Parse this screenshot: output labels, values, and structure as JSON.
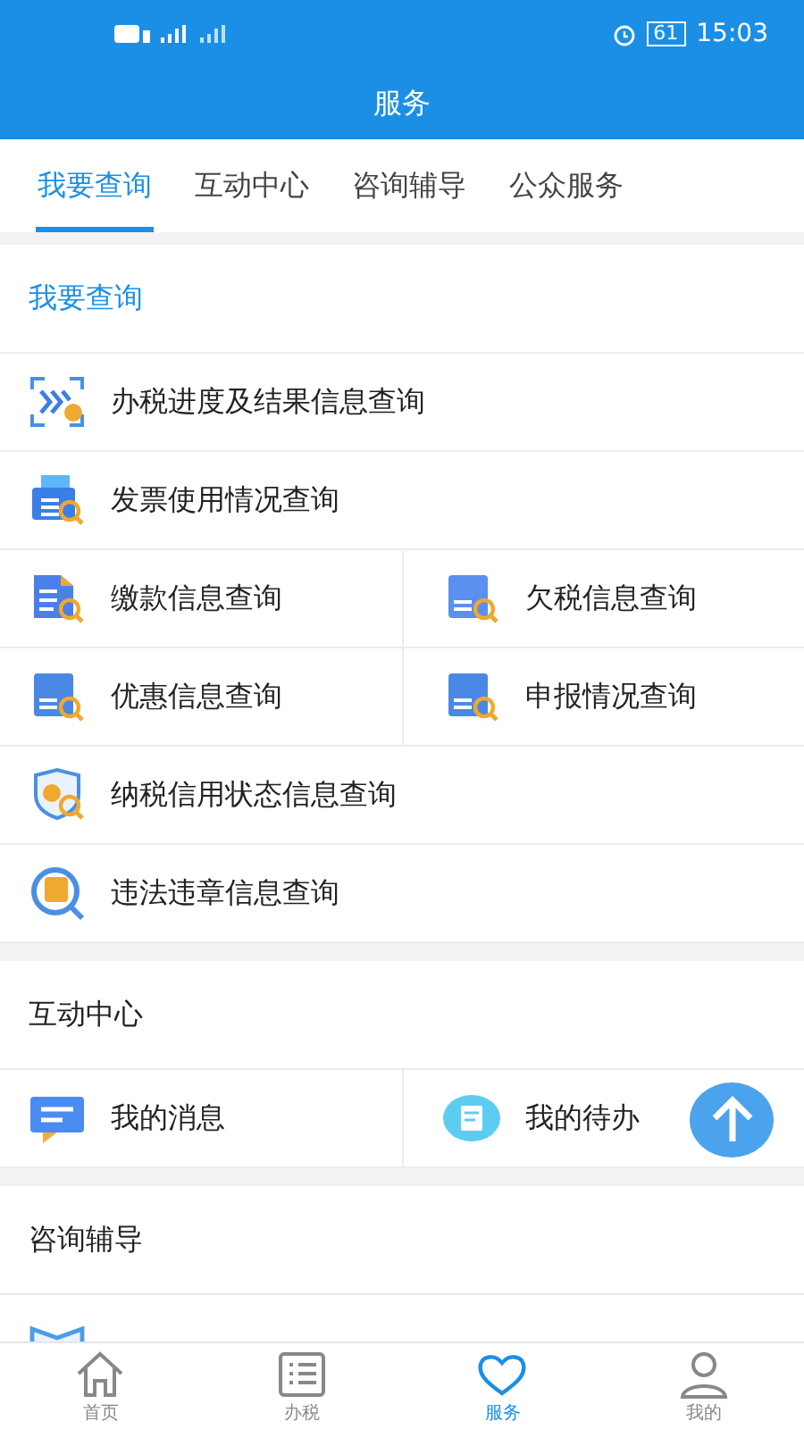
{
  "status_bar": {
    "battery": "61",
    "time": "15:03"
  },
  "title": "服务",
  "tabs": [
    {
      "label": "我要查询",
      "selected": true
    },
    {
      "label": "互动中心",
      "selected": false
    },
    {
      "label": "咨询辅导",
      "selected": false
    },
    {
      "label": "公众服务",
      "selected": false
    }
  ],
  "sections": [
    {
      "title": "我要查询",
      "highlighted": true,
      "rows": [
        [
          {
            "kind": "progress",
            "label": "办税进度及结果信息查询"
          }
        ],
        [
          {
            "kind": "invoice",
            "label": "发票使用情况查询"
          }
        ],
        [
          {
            "kind": "payment",
            "label": "缴款信息查询"
          },
          {
            "kind": "arrears",
            "label": "欠税信息查询"
          }
        ],
        [
          {
            "kind": "discount",
            "label": "优惠信息查询"
          },
          {
            "kind": "declaration",
            "label": "申报情况查询"
          }
        ],
        [
          {
            "kind": "credit",
            "label": "纳税信用状态信息查询"
          }
        ],
        [
          {
            "kind": "violation",
            "label": "违法违章信息查询"
          }
        ]
      ]
    },
    {
      "title": "互动中心",
      "highlighted": false,
      "rows": [
        [
          {
            "kind": "message",
            "label": "我的消息"
          },
          {
            "kind": "todo",
            "label": "我的待办"
          }
        ]
      ]
    },
    {
      "title": "咨询辅导",
      "highlighted": false,
      "rows": [
        [
          {
            "kind": "book"
          }
        ]
      ]
    }
  ],
  "nav": [
    {
      "kind": "home",
      "label": "首页",
      "selected": false
    },
    {
      "kind": "list",
      "label": "办税",
      "selected": false
    },
    {
      "kind": "heart",
      "label": "服务",
      "selected": true
    },
    {
      "kind": "person",
      "label": "我的",
      "selected": false
    }
  ]
}
